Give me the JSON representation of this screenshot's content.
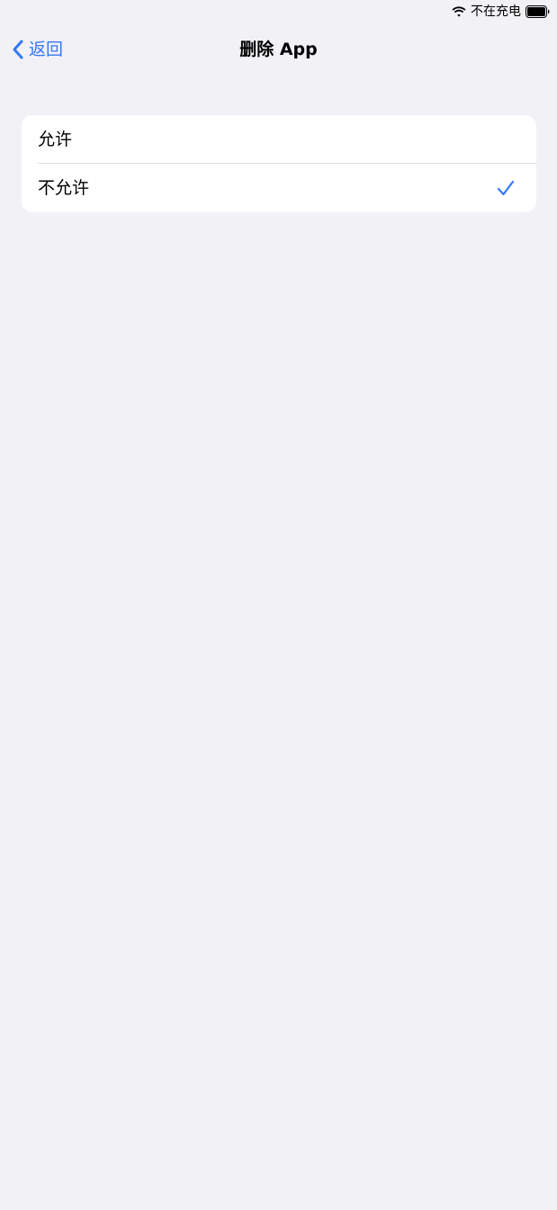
{
  "status_bar": {
    "charging_text": "不在充电"
  },
  "nav": {
    "back_label": "返回",
    "title": "删除 App"
  },
  "options": [
    {
      "label": "允许",
      "selected": false
    },
    {
      "label": "不允许",
      "selected": true
    }
  ],
  "icons": {
    "wifi": "wifi-icon",
    "battery": "battery-icon",
    "back": "chevron-left-icon",
    "check": "checkmark-icon"
  },
  "colors": {
    "accent": "#3478f6",
    "background": "#f2f1f6",
    "card": "#ffffff",
    "separator": "#dcdce0"
  }
}
